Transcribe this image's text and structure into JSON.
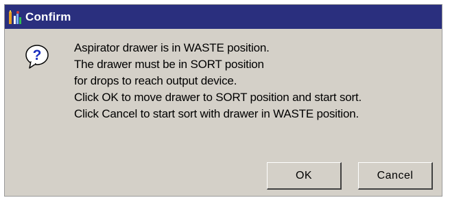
{
  "window": {
    "title": "Confirm",
    "icon": "app-icon"
  },
  "dialog": {
    "icon": "question-icon",
    "message_lines": [
      "Aspirator drawer is in WASTE position.",
      "The drawer must be in SORT position",
      "for drops to reach output device.",
      "Click OK to move drawer to SORT position and start sort.",
      "Click Cancel to start sort with drawer in WASTE position."
    ]
  },
  "buttons": {
    "ok_label": "OK",
    "cancel_label": "Cancel"
  },
  "colors": {
    "titlebar": "#2a2f7e",
    "dialog_background": "#d4d0c8",
    "question_icon_blue": "#1a2fbf"
  }
}
